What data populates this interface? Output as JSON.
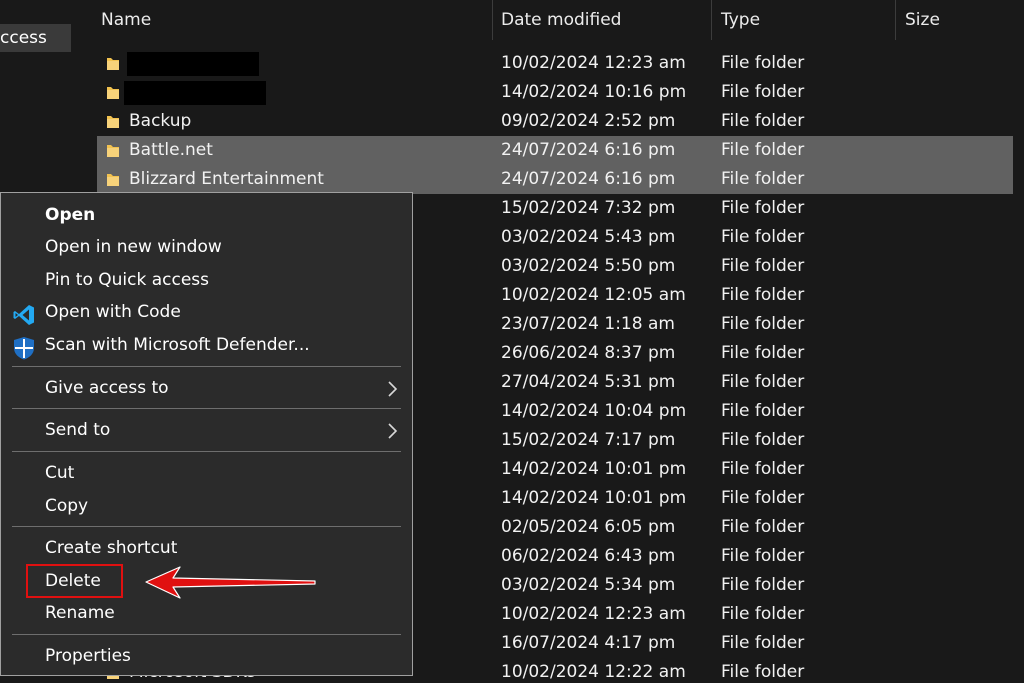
{
  "nav": {
    "quick_access_label": "ccess"
  },
  "columns": {
    "name": "Name",
    "date": "Date modified",
    "type": "Type",
    "size": "Size"
  },
  "rows": [
    {
      "name": "",
      "date": "10/02/2024 12:23 am",
      "type": "File folder",
      "redacted": true
    },
    {
      "name": "",
      "date": "14/02/2024 10:16 pm",
      "type": "File folder",
      "redacted": true
    },
    {
      "name": "Backup",
      "date": "09/02/2024 2:52 pm",
      "type": "File folder"
    },
    {
      "name": "Battle.net",
      "date": "24/07/2024 6:16 pm",
      "type": "File folder",
      "selected": true
    },
    {
      "name": "Blizzard Entertainment",
      "date": "24/07/2024 6:16 pm",
      "type": "File folder",
      "selected": true
    },
    {
      "name": "",
      "date": "15/02/2024 7:32 pm",
      "type": "File folder"
    },
    {
      "name": "",
      "date": "03/02/2024 5:43 pm",
      "type": "File folder"
    },
    {
      "name": "",
      "date": "03/02/2024 5:50 pm",
      "type": "File folder"
    },
    {
      "name": "",
      "date": "10/02/2024 12:05 am",
      "type": "File folder"
    },
    {
      "name": "",
      "date": "23/07/2024 1:18 am",
      "type": "File folder"
    },
    {
      "name": "",
      "date": "26/06/2024 8:37 pm",
      "type": "File folder"
    },
    {
      "name": "",
      "date": "27/04/2024 5:31 pm",
      "type": "File folder"
    },
    {
      "name": "",
      "date": "14/02/2024 10:04 pm",
      "type": "File folder"
    },
    {
      "name": "",
      "date": "15/02/2024 7:17 pm",
      "type": "File folder"
    },
    {
      "name": "",
      "date": "14/02/2024 10:01 pm",
      "type": "File folder"
    },
    {
      "name": "",
      "date": "14/02/2024 10:01 pm",
      "type": "File folder"
    },
    {
      "name": "",
      "date": "02/05/2024 6:05 pm",
      "type": "File folder"
    },
    {
      "name": "",
      "date": "06/02/2024 6:43 pm",
      "type": "File folder"
    },
    {
      "name": "",
      "date": "03/02/2024 5:34 pm",
      "type": "File folder"
    },
    {
      "name": "",
      "date": "10/02/2024 12:23 am",
      "type": "File folder"
    },
    {
      "name": "",
      "date": "16/07/2024 4:17 pm",
      "type": "File folder"
    },
    {
      "name": "Microsoft SDKs",
      "date": "10/02/2024 12:22 am",
      "type": "File folder"
    }
  ],
  "context_menu": {
    "open": "Open",
    "open_new_window": "Open in new window",
    "pin_quick_access": "Pin to Quick access",
    "open_with_code": "Open with Code",
    "scan_defender": "Scan with Microsoft Defender...",
    "give_access": "Give access to",
    "send_to": "Send to",
    "cut": "Cut",
    "copy": "Copy",
    "create_shortcut": "Create shortcut",
    "delete": "Delete",
    "rename": "Rename",
    "properties": "Properties"
  },
  "icons": {
    "folder": "folder-icon",
    "vscode": "vscode-icon",
    "defender": "defender-shield-icon",
    "submenu": "chevron-right-icon"
  },
  "colors": {
    "folder": "#f2c24f",
    "selection": "#616161",
    "menu_bg": "#2b2b2b",
    "annotation_red": "#e01010",
    "vscode_blue": "#23a9f2",
    "defender_blue": "#1f6fc4"
  }
}
